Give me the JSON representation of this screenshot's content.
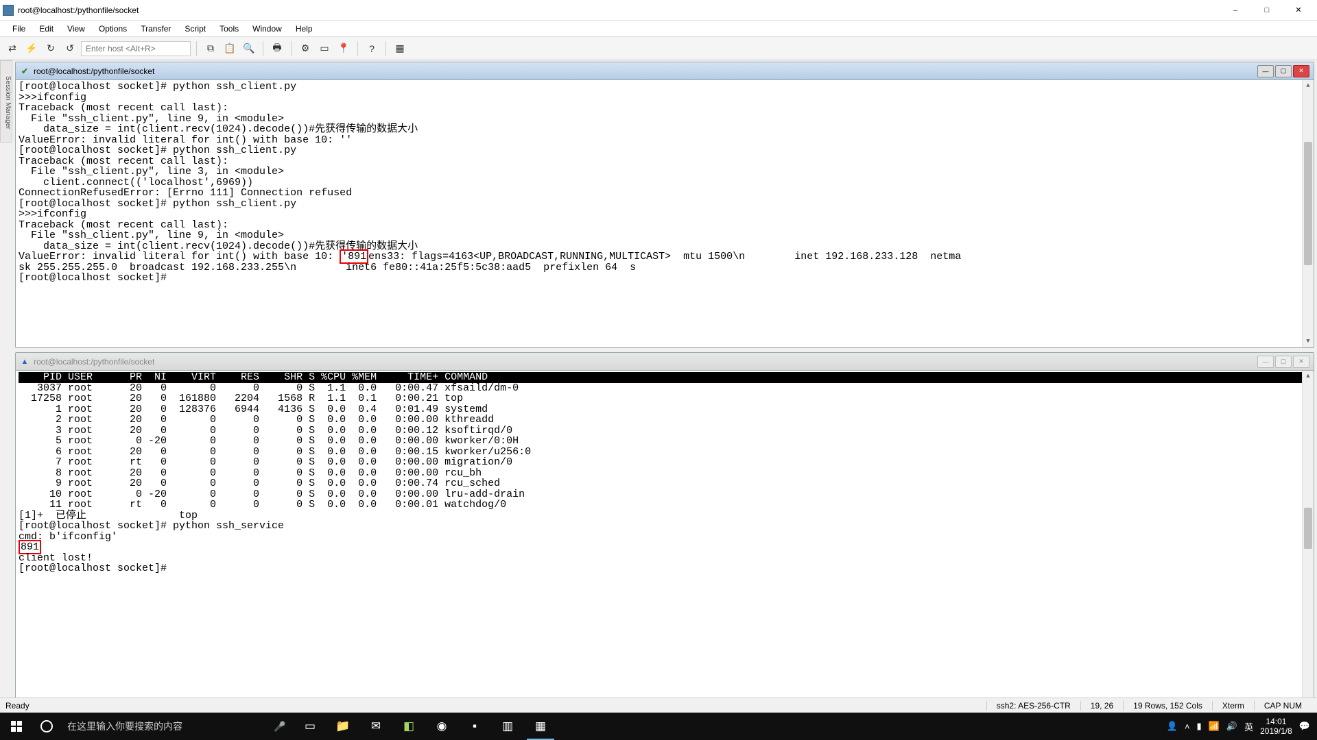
{
  "window": {
    "title": "root@localhost:/pythonfile/socket"
  },
  "menu": {
    "items": [
      "File",
      "Edit",
      "View",
      "Options",
      "Transfer",
      "Script",
      "Tools",
      "Window",
      "Help"
    ]
  },
  "toolbar": {
    "host_placeholder": "Enter host <Alt+R>"
  },
  "session_sidebar": {
    "label": "Session Manager"
  },
  "pane1": {
    "title": "root@localhost:/pythonfile/socket",
    "lines_a": "[root@localhost socket]# python ssh_client.py\n>>>ifconfig\nTraceback (most recent call last):\n  File \"ssh_client.py\", line 9, in <module>\n    data_size = int(client.recv(1024).decode())#先获得传输的数据大小\nValueError: invalid literal for int() with base 10: ''\n[root@localhost socket]# python ssh_client.py\nTraceback (most recent call last):\n  File \"ssh_client.py\", line 3, in <module>\n    client.connect(('localhost',6969))\nConnectionRefusedError: [Errno 111] Connection refused\n[root@localhost socket]# python ssh_client.py\n>>>ifconfig\nTraceback (most recent call last):\n  File \"ssh_client.py\", line 9, in <module>\n    data_size = int(client.recv(1024).decode())#先获得传输的数据大小",
    "line_err_pre": "ValueError: invalid literal for int() with base 10: ",
    "line_err_box": "'891",
    "line_err_post": "ens33: flags=4163<UP,BROADCAST,RUNNING,MULTICAST>  mtu 1500\\n        inet 192.168.233.128  netma",
    "lines_b": "sk 255.255.255.0  broadcast 192.168.233.255\\n        inet6 fe80::41a:25f5:5c38:aad5  prefixlen 64  s\n[root@localhost socket]# "
  },
  "pane2": {
    "title": "root@localhost:/pythonfile/socket",
    "header": "    PID USER      PR  NI    VIRT    RES    SHR S %CPU %MEM     TIME+ COMMAND                                                                                    ",
    "rows": "   3037 root      20   0       0      0      0 S  1.1  0.0   0:00.47 xfsaild/dm-0\n  17258 root      20   0  161880   2204   1568 R  1.1  0.1   0:00.21 top\n      1 root      20   0  128376   6944   4136 S  0.0  0.4   0:01.49 systemd\n      2 root      20   0       0      0      0 S  0.0  0.0   0:00.00 kthreadd\n      3 root      20   0       0      0      0 S  0.0  0.0   0:00.12 ksoftirqd/0\n      5 root       0 -20       0      0      0 S  0.0  0.0   0:00.00 kworker/0:0H\n      6 root      20   0       0      0      0 S  0.0  0.0   0:00.15 kworker/u256:0\n      7 root      rt   0       0      0      0 S  0.0  0.0   0:00.00 migration/0\n      8 root      20   0       0      0      0 S  0.0  0.0   0:00.00 rcu_bh\n      9 root      20   0       0      0      0 S  0.0  0.0   0:00.74 rcu_sched\n     10 root       0 -20       0      0      0 S  0.0  0.0   0:00.00 lru-add-drain\n     11 root      rt   0       0      0      0 S  0.0  0.0   0:00.01 watchdog/0",
    "after_a": "[1]+  已停止               top\n[root@localhost socket]# python ssh_service\ncmd: b'ifconfig'",
    "boxed": "891",
    "after_b": "client lost!\n[root@localhost socket]# "
  },
  "status": {
    "ready": "Ready",
    "ssh": "ssh2: AES-256-CTR",
    "pos": "19, 26",
    "size": "19 Rows, 152 Cols",
    "term": "Xterm",
    "caps": "CAP NUM"
  },
  "taskbar": {
    "search_placeholder": "在这里输入你要搜索的内容",
    "ime": "英",
    "time": "14:01",
    "date": "2019/1/8"
  }
}
